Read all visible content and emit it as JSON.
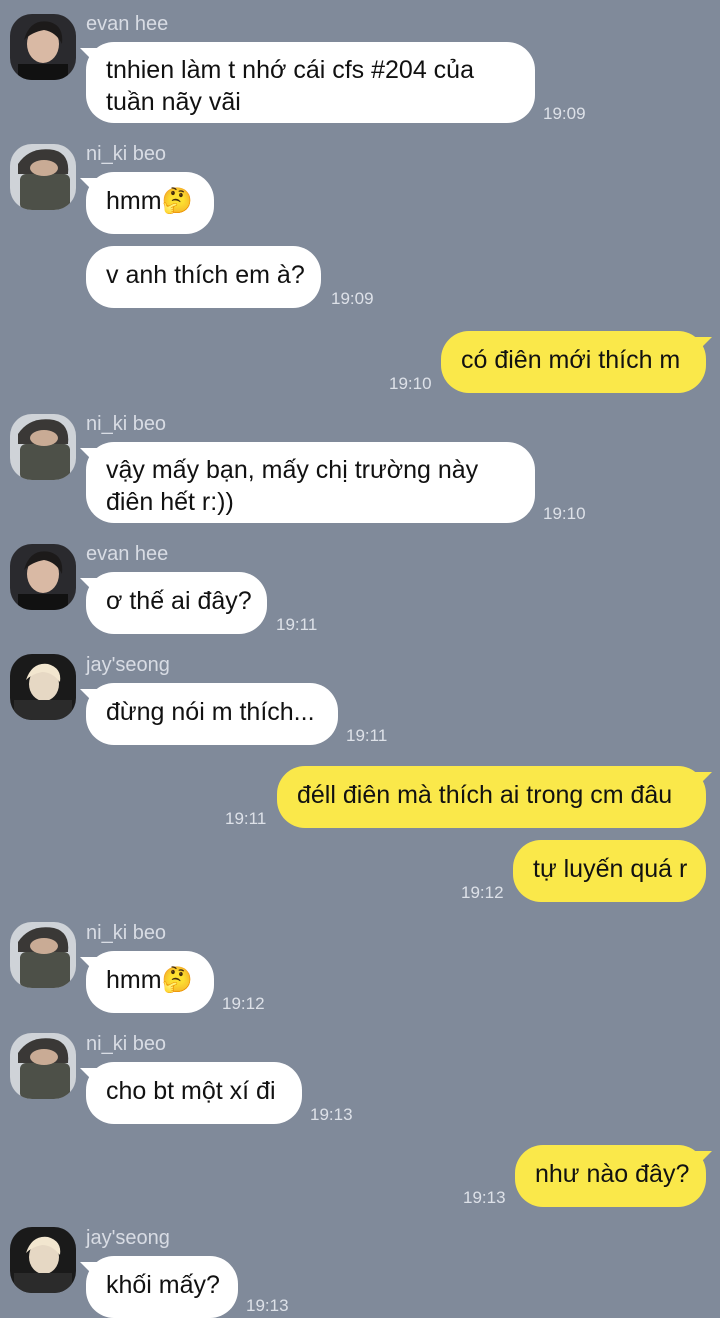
{
  "messages": [
    {
      "sender": "evan hee",
      "text_lines": [
        "tnhien làm t nhớ cái cfs #204 của",
        "tuần nãy vãi"
      ],
      "time": "19:09",
      "direction": "in"
    },
    {
      "sender": "ni_ki beo",
      "text": "hmm🤔",
      "direction": "in"
    },
    {
      "text": "v anh thích em à?",
      "time": "19:09",
      "direction": "in"
    },
    {
      "text": "có điên mới thích m",
      "time": "19:10",
      "direction": "out"
    },
    {
      "sender": "ni_ki beo",
      "text_lines": [
        "vậy mấy bạn, mấy chị trường này",
        "điên hết r:))"
      ],
      "time": "19:10",
      "direction": "in"
    },
    {
      "sender": "evan hee",
      "text": "ơ thế ai đây?",
      "time": "19:11",
      "direction": "in"
    },
    {
      "sender": "jay'seong",
      "text": "đừng nói m thích...",
      "time": "19:11",
      "direction": "in"
    },
    {
      "text": "đéll điên mà thích ai trong cm đâu",
      "time": "19:11",
      "direction": "out"
    },
    {
      "text": "tự luyến quá r",
      "time": "19:12",
      "direction": "out"
    },
    {
      "sender": "ni_ki beo",
      "text": "hmm🤔",
      "time": "19:12",
      "direction": "in"
    },
    {
      "sender": "ni_ki beo",
      "text": "cho bt một xí đi",
      "time": "19:13",
      "direction": "in"
    },
    {
      "text": "như nào đây?",
      "time": "19:13",
      "direction": "out"
    },
    {
      "sender": "jay'seong",
      "text": "khối mấy?",
      "time": "19:13",
      "direction": "in"
    }
  ],
  "colors": {
    "background": "#808a9a",
    "incoming_bubble": "#ffffff",
    "outgoing_bubble": "#fae84a",
    "sender_text": "#d8dce4",
    "time_text": "#dde1e8"
  },
  "icons": {
    "evan_hee": "avatar-evan-hee",
    "ni_ki_beo": "avatar-ni-ki-beo",
    "jayseong": "avatar-jayseong"
  }
}
